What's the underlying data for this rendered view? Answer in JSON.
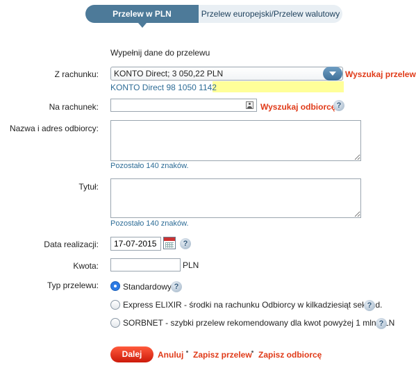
{
  "tabs": {
    "active": "Przelew w PLN",
    "inactive": "Przelew europejski/Przelew walutowy"
  },
  "intro": "Wypełnij dane do przelewu",
  "from_account": {
    "label": "Z rachunku:",
    "selected": "KONTO Direct; 3 050,22 PLN",
    "search_link": "Wyszukaj przelew",
    "account_number": "KONTO Direct 98 1050 1142"
  },
  "to_account": {
    "label": "Na rachunek:",
    "value": "",
    "search_link": "Wyszukaj odbiorcę"
  },
  "recipient": {
    "label": "Nazwa i adres odbiorcy:",
    "value": "",
    "counter": "Pozostało 140 znaków."
  },
  "title": {
    "label": "Tytuł:",
    "value": "",
    "counter": "Pozostało 140 znaków."
  },
  "date": {
    "label": "Data realizacji:",
    "value": "17-07-2015"
  },
  "amount": {
    "label": "Kwota:",
    "value": "",
    "currency": "PLN"
  },
  "transfer_type": {
    "label": "Typ przelewu:",
    "options": [
      {
        "label": "Standardowy",
        "selected": true
      },
      {
        "label": "Express ELIXIR - środki na rachunku Odbiorcy w kilkadziesiąt sekund.",
        "selected": false
      },
      {
        "label": "SORBNET - szybki przelew rekomendowany dla kwot powyżej 1 mln PLN",
        "selected": false
      }
    ]
  },
  "help_glyph": "?",
  "actions": {
    "next": "Dalej",
    "cancel": "Anuluj",
    "save_transfer": "Zapisz przelew",
    "save_recipient": "Zapisz odbiorcę"
  },
  "colors": {
    "tab_active": "#4d7a99",
    "link_red": "#e03a18",
    "link_blue": "#2d6c96",
    "highlight": "#ffff99",
    "radio_selected": "#2c7be5"
  },
  "icons": [
    "chevron-down-icon",
    "address-book-icon",
    "help-icon",
    "calendar-icon"
  ]
}
